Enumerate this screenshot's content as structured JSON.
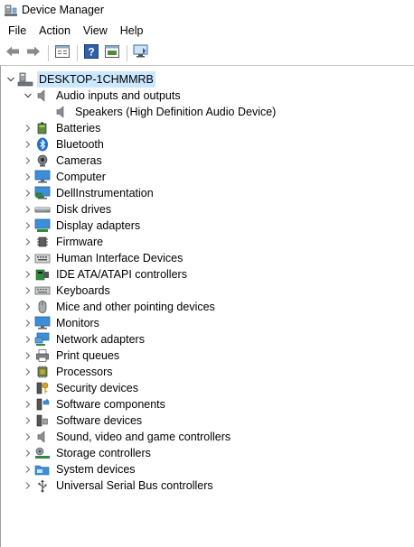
{
  "window": {
    "title": "Device Manager"
  },
  "menu": [
    "File",
    "Action",
    "View",
    "Help"
  ],
  "toolbar": [
    "back-arrow-icon",
    "forward-arrow-icon",
    "properties-sheet-icon",
    "help-icon",
    "update-driver-icon",
    "monitor-scan-icon"
  ],
  "tree": {
    "root": "DESKTOP-1CHMMRB",
    "expanded_category": "Audio inputs and outputs",
    "expanded_child": "Speakers (High Definition Audio Device)",
    "categories": [
      "Batteries",
      "Bluetooth",
      "Cameras",
      "Computer",
      "DellInstrumentation",
      "Disk drives",
      "Display adapters",
      "Firmware",
      "Human Interface Devices",
      "IDE ATA/ATAPI controllers",
      "Keyboards",
      "Mice and other pointing devices",
      "Monitors",
      "Network adapters",
      "Print queues",
      "Processors",
      "Security devices",
      "Software components",
      "Software devices",
      "Sound, video and game controllers",
      "Storage controllers",
      "System devices",
      "Universal Serial Bus controllers"
    ]
  },
  "colors": {
    "selection": "#cce8ff",
    "accent": "#0078d7"
  }
}
